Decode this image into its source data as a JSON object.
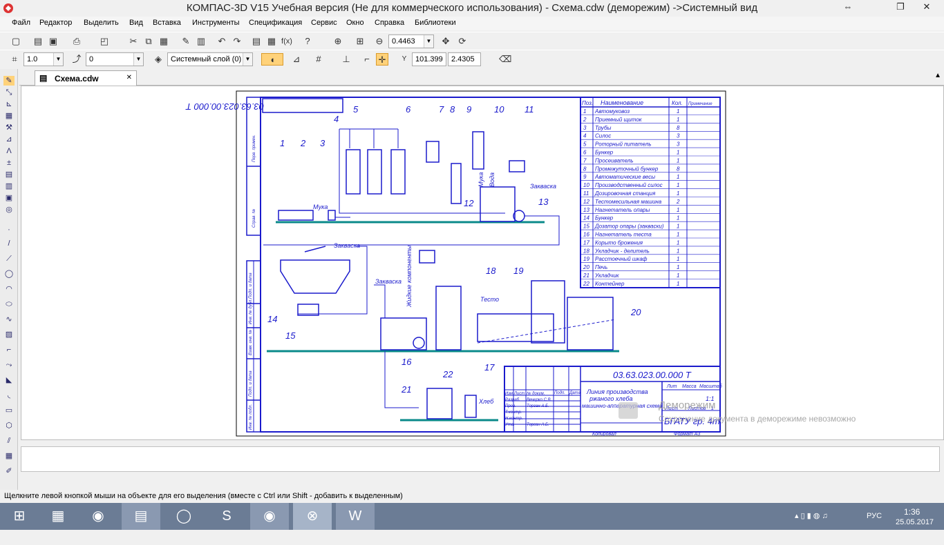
{
  "window": {
    "title": "КОМПАС-3D V15 Учебная версия (Не для коммерческого использования) - Схема.cdw (деморежим) ->Системный вид",
    "btn_minimize": "⇔",
    "btn_restore": "❐",
    "btn_close": "✕"
  },
  "menu": [
    "Файл",
    "Редактор",
    "Выделить",
    "Вид",
    "Вставка",
    "Инструменты",
    "Спецификация",
    "Сервис",
    "Окно",
    "Справка",
    "Библиотеки"
  ],
  "toolbar1": {
    "zoom_value": "0.4463"
  },
  "toolbar2": {
    "step_value": "1.0",
    "angle_value": "0",
    "layer_value": "Системный слой (0)",
    "coord_x": "101.399",
    "coord_y": "2.4305",
    "coord_label": "Y"
  },
  "document_tab": {
    "label": "Схема.cdw",
    "close": "✕"
  },
  "drawing": {
    "code": "03.63.023.00.000 Т",
    "code_rotated": "03.63.023.00.000 Т",
    "title_block": {
      "name_line1": "Линия производства",
      "name_line2": "ржаного хлеба",
      "name_line3": "машинно-аппаратурная схема",
      "lit_head": "Лит",
      "mass_head": "Масса",
      "scale_head": "Масштаб",
      "sheet_num": "1:1",
      "sheet_label": "Лист",
      "sheets_label": "Листов",
      "sheets_value": "1",
      "org": "БГАТУ гр. 4т",
      "copied": "Копировал",
      "format": "Формат А3",
      "roles": [
        "Изм Лист",
        "Разраб.",
        "Пров.",
        "Т.контр.",
        "Н.контр.",
        "Утв."
      ],
      "people": [
        "№ докум.",
        "Вечерко С.В.",
        "Торган А.Б.",
        "",
        "",
        "Торган А.Б."
      ],
      "col_sign": "Подп.",
      "col_date": "Дата"
    },
    "spec_headers": {
      "pos": "Поз.",
      "name": "Наименование",
      "qty": "Кол.",
      "note": "Примечание"
    },
    "spec_rows": [
      {
        "pos": "1",
        "name": "Автомуковоз",
        "qty": "1"
      },
      {
        "pos": "2",
        "name": "Приемный щиток",
        "qty": "1"
      },
      {
        "pos": "3",
        "name": "Трубы",
        "qty": "8"
      },
      {
        "pos": "4",
        "name": "Силос",
        "qty": "3"
      },
      {
        "pos": "5",
        "name": "Роторный питатель",
        "qty": "3"
      },
      {
        "pos": "6",
        "name": "Бункер",
        "qty": "1"
      },
      {
        "pos": "7",
        "name": "Просеиватель",
        "qty": "1"
      },
      {
        "pos": "8",
        "name": "Промежуточный бункер",
        "qty": "8"
      },
      {
        "pos": "9",
        "name": "Автоматические весы",
        "qty": "1"
      },
      {
        "pos": "10",
        "name": "Производственный силос",
        "qty": "1"
      },
      {
        "pos": "11",
        "name": "Дозировочная станция",
        "qty": "1"
      },
      {
        "pos": "12",
        "name": "Тестомесильная машина",
        "qty": "2"
      },
      {
        "pos": "13",
        "name": "Нагнетатель опары",
        "qty": "1"
      },
      {
        "pos": "14",
        "name": "Бункер",
        "qty": "1"
      },
      {
        "pos": "15",
        "name": "Дозатор опары (закваски)",
        "qty": "1"
      },
      {
        "pos": "16",
        "name": "Нагнетатель теста",
        "qty": "1"
      },
      {
        "pos": "17",
        "name": "Корыто брожения",
        "qty": "1"
      },
      {
        "pos": "18",
        "name": "Укладчик - делитель",
        "qty": "1"
      },
      {
        "pos": "19",
        "name": "Расстоечный шкаф",
        "qty": "1"
      },
      {
        "pos": "20",
        "name": "Печь",
        "qty": "1"
      },
      {
        "pos": "21",
        "name": "Укладчик",
        "qty": "1"
      },
      {
        "pos": "22",
        "name": "Контейнер",
        "qty": "1"
      }
    ],
    "callouts": [
      "1",
      "2",
      "3",
      "4",
      "5",
      "6",
      "7",
      "8",
      "9",
      "10",
      "11",
      "12",
      "13",
      "14",
      "15",
      "16",
      "17",
      "18",
      "19",
      "20",
      "21",
      "22"
    ],
    "labels": {
      "flour": "Мука",
      "flour2": "Мука",
      "water": "Вода",
      "starter1": "Закваска",
      "starter2": "Закваска",
      "starter3": "Закваска",
      "liquid": "Жидкие компоненты",
      "dough": "Тесто",
      "bread": "Хлеб"
    },
    "side_stamp": [
      "Перв. примен.",
      "Справ. №",
      "Подп. и дата",
      "Инв. № дубл.",
      "Взам. инв. №",
      "Подп. и дата",
      "Инв. № подл."
    ]
  },
  "watermark": {
    "title": "Деморежим",
    "text": "Сохранение документа в деморежиме невозможно"
  },
  "status": "Щелкните левой кнопкой мыши на объекте для его выделения (вместе с Ctrl или Shift - добавить к выделенным)",
  "tray": {
    "lang": "РУС",
    "time": "1:36",
    "date": "25.05.2017"
  }
}
